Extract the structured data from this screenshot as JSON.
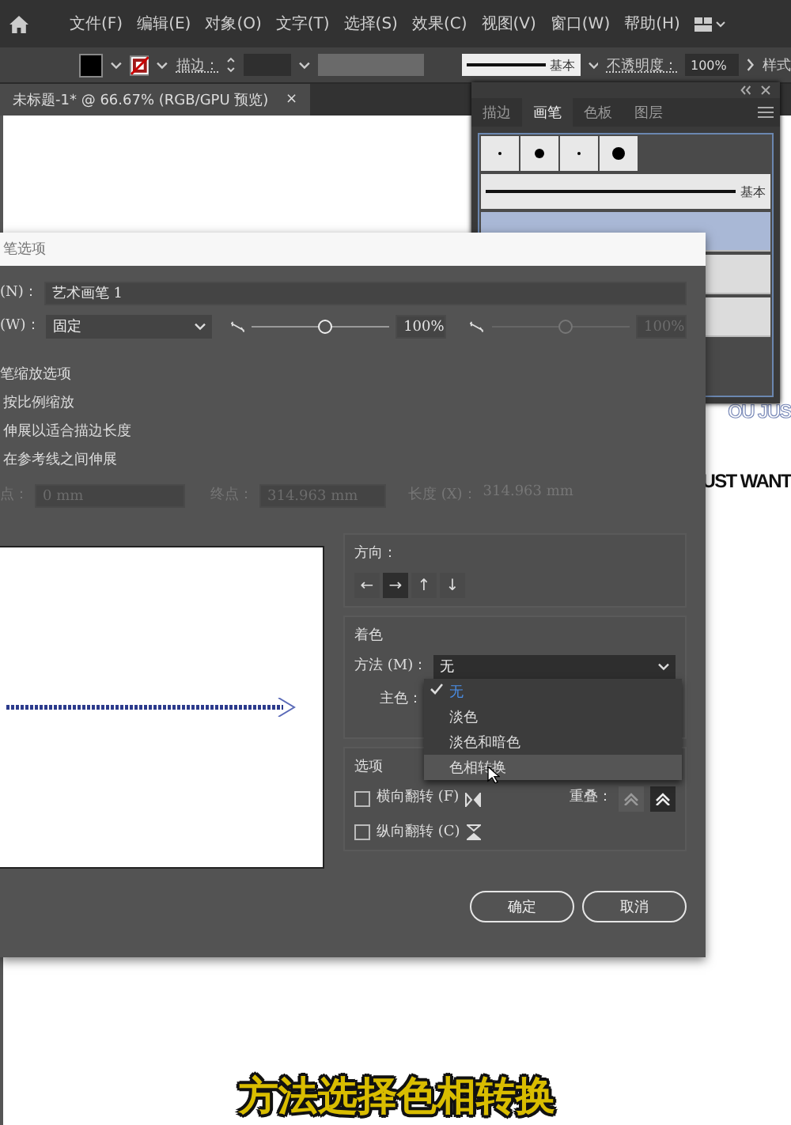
{
  "menu_bar": {
    "items": [
      "文件(F)",
      "编辑(E)",
      "对象(O)",
      "文字(T)",
      "选择(S)",
      "效果(C)",
      "视图(V)",
      "窗口(W)",
      "帮助(H)"
    ]
  },
  "control_bar": {
    "stroke_label": "描边：",
    "brush_label": "基本",
    "opacity_label": "不透明度：",
    "opacity_value": "100%",
    "style_label": "样式"
  },
  "document_tab": {
    "title": "未标题-1* @ 66.67% (RGB/GPU 预览)",
    "close": "×"
  },
  "canvas": {
    "texts": [
      "OU JUS",
      "UST WANT"
    ]
  },
  "brushes_panel": {
    "tabs": [
      {
        "label": "描边",
        "selected": false
      },
      {
        "label": "画笔",
        "selected": true
      },
      {
        "label": "色板",
        "selected": false
      },
      {
        "label": "图层",
        "selected": false
      }
    ],
    "basic_label": "基本"
  },
  "dialog": {
    "title": "笔选项",
    "name_label": "(N)：",
    "name_value": "艺术画笔 1",
    "width_label": "(W)：",
    "width_value": "固定",
    "width_slider": {
      "level": 0.5
    },
    "width_slider_disabled": {
      "level": 0.5
    },
    "width_percent": "100%",
    "width_percent_disabled": "100%",
    "scale_section": "笔缩放选项",
    "scale_options": [
      "按比例缩放",
      "伸展以适合描边长度",
      "在参考线之间伸展"
    ],
    "start_label": "点：",
    "start_value": "0 mm",
    "end_label": "终点：",
    "end_value": "314.963 mm",
    "length_label": "长度 (X)：",
    "length_value": "314.963 mm",
    "direction_label": "方向：",
    "directions": [
      {
        "symbol": "←",
        "selected": false
      },
      {
        "symbol": "→",
        "selected": true
      },
      {
        "symbol": "↑",
        "selected": false
      },
      {
        "symbol": "↓",
        "selected": false
      }
    ],
    "coloring_label": "着色",
    "method_label": "方法 (M)：",
    "method_value": "无",
    "key_color_label": "主色：",
    "method_options": [
      {
        "label": "无",
        "checked": true,
        "hovered": false
      },
      {
        "label": "淡色",
        "checked": false,
        "hovered": false
      },
      {
        "label": "淡色和暗色",
        "checked": false,
        "hovered": false
      },
      {
        "label": "色相转换",
        "checked": false,
        "hovered": true
      }
    ],
    "options_label": "选项",
    "flip_along": {
      "label": "横向翻转 (F)",
      "checked": false
    },
    "flip_across": {
      "label": "纵向翻转 (C)",
      "checked": false
    },
    "overlap_label": "重叠：",
    "overlap": [
      {
        "selected": false
      },
      {
        "selected": true
      }
    ],
    "ok": "确定",
    "cancel": "取消"
  },
  "caption": "方法选择色相转换"
}
